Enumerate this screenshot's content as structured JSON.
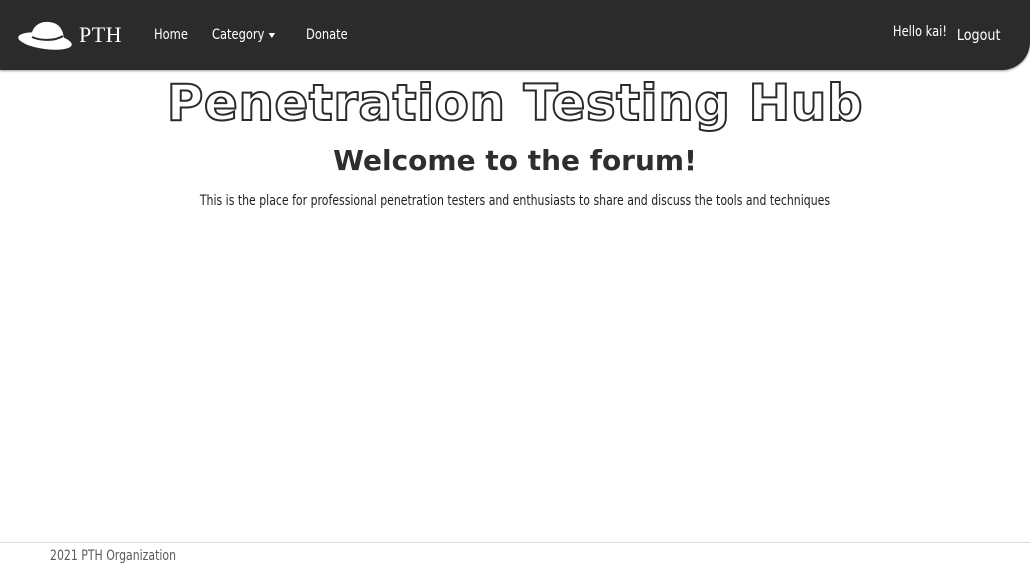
{
  "navbar": {
    "brand_text": "PTH",
    "brand_icon": "fedora-hat-icon",
    "links": [
      {
        "label": "Home"
      },
      {
        "label": "Category"
      },
      {
        "label": "Donate"
      }
    ],
    "greeting": "Hello kai!",
    "logout_label": "Logout",
    "background_color": "#2b2b2b"
  },
  "hero": {
    "title": "Penetration Testing Hub",
    "subtitle": "Welcome to the forum!",
    "description": "This is the place for professional penetration testers and enthusiasts to share and discuss the tools and techniques"
  },
  "footer": {
    "text": "2021 PTH Organization"
  }
}
